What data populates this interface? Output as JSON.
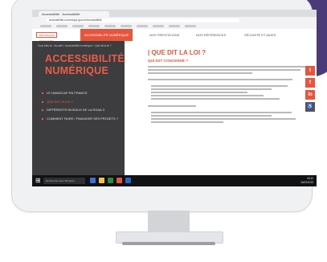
{
  "browser": {
    "tab_title": "Accessibilité · Accessibilité ·",
    "url": "accessibilite-numerique.gouv.fr/accessibilite"
  },
  "site_nav": {
    "logo": "RÉPUBLIQUE FRANÇAISE",
    "items": [
      {
        "label": "ACCESSIBILITÉ NUMÉRIQUE"
      },
      {
        "label": "NOS PRESTATIONS"
      },
      {
        "label": "NOS RÉFÉRENCES"
      },
      {
        "label": "SÉCURITÉ ET AIDES"
      }
    ]
  },
  "sidebar": {
    "breadcrumb": "Vous êtes ici : Accueil > Accessibilité numérique > Que dit la loi ?",
    "title_line1": "ACCESSIBILITÉ",
    "title_line2": "NUMÉRIQUE",
    "menu": [
      {
        "label": "LE HANDICAP EN FRANCE",
        "active": false
      },
      {
        "label": "QUE DIT LA LOI ?",
        "active": true
      },
      {
        "label": "DIFFÉRENTS NIVEAUX DE LA RGAA 3",
        "active": false
      },
      {
        "label": "COMMENT FAIRE / FINANCER SES PROJETS ?",
        "active": false
      }
    ]
  },
  "content": {
    "heading": "| QUE DIT LA LOI ?",
    "subheading": "QUI EST CONCERNÉ ?"
  },
  "social": [
    "t",
    "f",
    "in",
    "♿"
  ],
  "taskbar": {
    "search_placeholder": "Rechercher dans Windows",
    "time": "18:42",
    "date": "26/03/2019"
  },
  "colors": {
    "accent": "#e8553d",
    "sidebar_bg": "#3d3d3f",
    "blob": "#4b3a7a"
  }
}
